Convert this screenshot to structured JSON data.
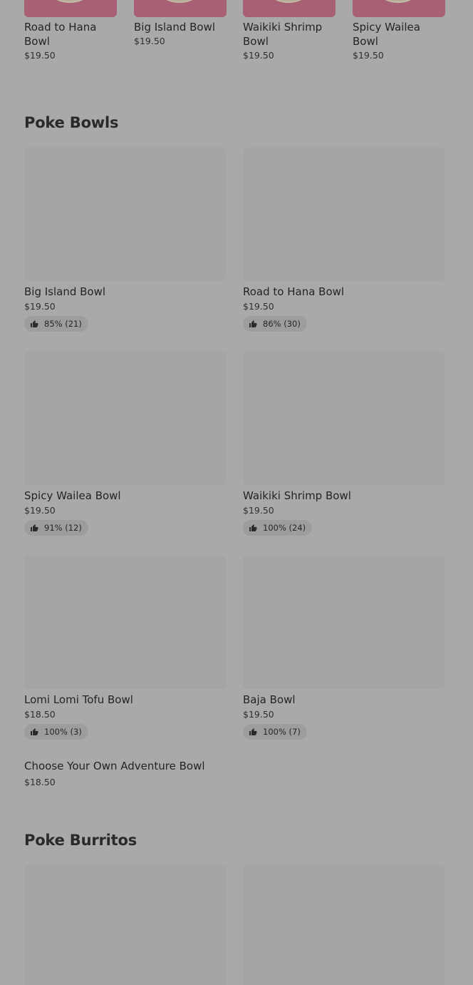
{
  "featured": [
    {
      "name": "Road to Hana Bowl",
      "price": "$19.50"
    },
    {
      "name": "Big Island Bowl",
      "price": "$19.50"
    },
    {
      "name": "Waikiki Shrimp Bowl",
      "price": "$19.50"
    },
    {
      "name": "Spicy Wailea Bowl",
      "price": "$19.50"
    }
  ],
  "sections": {
    "poke_bowls": {
      "title": "Poke Bowls",
      "items": [
        {
          "name": "Big Island Bowl",
          "price": "$19.50",
          "rating": "85% (21)"
        },
        {
          "name": "Road to Hana Bowl",
          "price": "$19.50",
          "rating": "86% (30)"
        },
        {
          "name": "Spicy Wailea Bowl",
          "price": "$19.50",
          "rating": "91% (12)"
        },
        {
          "name": "Waikiki Shrimp Bowl",
          "price": "$19.50",
          "rating": "100% (24)"
        },
        {
          "name": "Lomi Lomi Tofu Bowl",
          "price": "$18.50",
          "rating": "100% (3)"
        },
        {
          "name": "Baja Bowl",
          "price": "$19.50",
          "rating": "100% (7)"
        },
        {
          "name": "Choose Your Own Adventure Bowl",
          "price": "$18.50"
        }
      ]
    },
    "poke_burritos": {
      "title": "Poke Burritos"
    }
  },
  "icons": {
    "rating": "thumbs-up-icon"
  }
}
